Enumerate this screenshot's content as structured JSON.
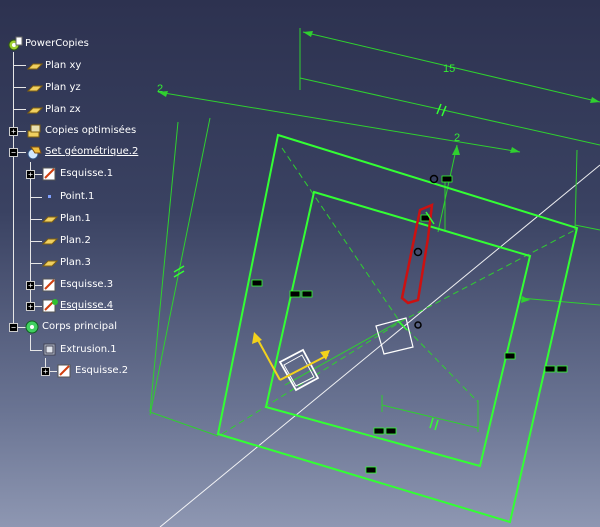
{
  "spec_tree": {
    "root_label": "PowerCopies",
    "items": [
      {
        "label": "Plan xy",
        "icon": "plane-icon"
      },
      {
        "label": "Plan yz",
        "icon": "plane-icon"
      },
      {
        "label": "Plan zx",
        "icon": "plane-icon"
      },
      {
        "label": "Copies optimisées",
        "icon": "optimized-copies-icon"
      },
      {
        "label": "Set géométrique.2",
        "icon": "geometrical-set-icon"
      },
      {
        "label": "Esquisse.1",
        "icon": "sketch-icon"
      },
      {
        "label": "Point.1",
        "icon": "point-icon"
      },
      {
        "label": "Plan.1",
        "icon": "plane-icon"
      },
      {
        "label": "Plan.2",
        "icon": "plane-icon"
      },
      {
        "label": "Plan.3",
        "icon": "plane-icon"
      },
      {
        "label": "Esquisse.3",
        "icon": "sketch-icon"
      },
      {
        "label": "Esquisse.4",
        "icon": "sketch-icon"
      },
      {
        "label": "Corps principal",
        "icon": "part-body-icon"
      },
      {
        "label": "Extrusion.1",
        "icon": "pad-icon"
      },
      {
        "label": "Esquisse.2",
        "icon": "sketch-icon"
      }
    ]
  },
  "dimensions": {
    "top_length": "15",
    "left_offset": "2",
    "inner_offset": "2"
  },
  "colors": {
    "sketch_geometry": "#33ff33",
    "dimension": "#2fd02f",
    "highlighted_profile": "#cc1111",
    "axis": "#ffffff",
    "tree_text": "#ffffff"
  }
}
